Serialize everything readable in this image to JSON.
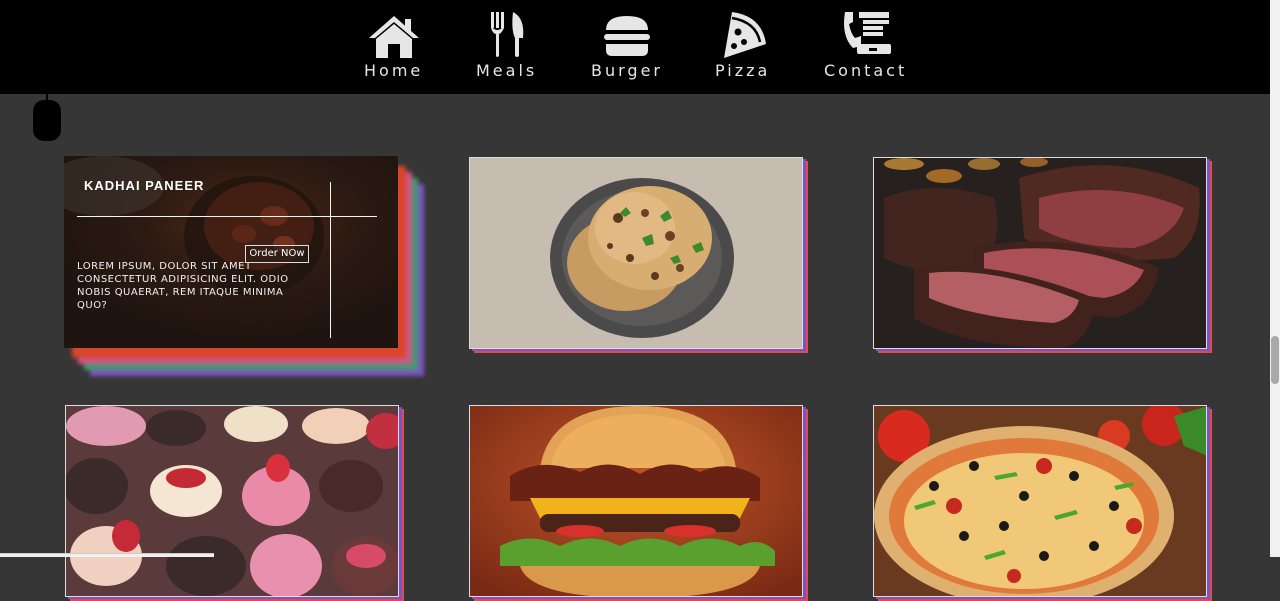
{
  "nav": {
    "items": [
      {
        "label": "Home",
        "icon": "home-icon"
      },
      {
        "label": "Meals",
        "icon": "fork-knife-icon"
      },
      {
        "label": "Burger",
        "icon": "burger-icon"
      },
      {
        "label": "Pizza",
        "icon": "pizza-icon"
      },
      {
        "label": "Contact",
        "icon": "phone-icon"
      }
    ]
  },
  "featured": {
    "title": "KADHAI PANEER",
    "description": "LOREM IPSUM, DOLOR SIT AMET CONSECTETUR ADIPISICING ELIT. ODIO NOBIS QUAERAT, REM ITAQUE MINIMA QUO?",
    "order_label": "Order NOw"
  },
  "cards": [
    {
      "name": "naan",
      "alt": "naan-bread-image"
    },
    {
      "name": "steak",
      "alt": "steak-image"
    },
    {
      "name": "desserts",
      "alt": "desserts-image"
    },
    {
      "name": "burger",
      "alt": "burger-image"
    },
    {
      "name": "pizza",
      "alt": "pizza-image"
    }
  ],
  "colors": {
    "background": "#363636",
    "nav_background": "#000000",
    "accent_red": "#e14b4b",
    "accent_purple": "#7a53c4"
  }
}
